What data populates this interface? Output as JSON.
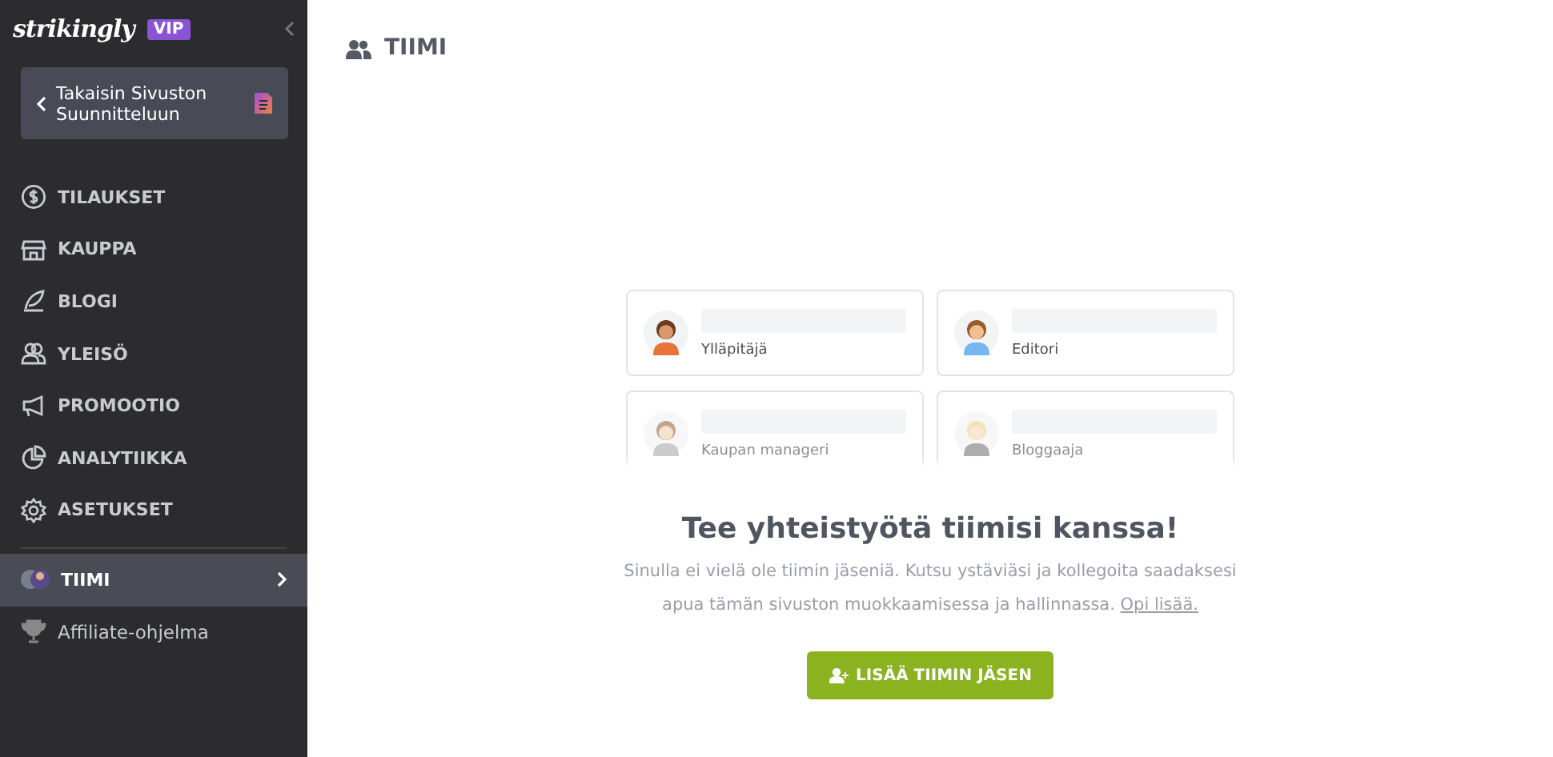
{
  "sidebar": {
    "logo": "strikingly",
    "badge": "VIP",
    "back_button": "Takaisin Sivuston Suunnitteluun",
    "items": [
      {
        "label": "TILAUKSET",
        "kind": "main",
        "selected": false
      },
      {
        "label": "KAUPPA",
        "kind": "main",
        "selected": false
      },
      {
        "label": "BLOGI",
        "kind": "main",
        "selected": false
      },
      {
        "label": "YLEISÖ",
        "kind": "main",
        "selected": false
      },
      {
        "label": "PROMOOTIO",
        "kind": "main",
        "selected": false
      },
      {
        "label": "ANALYTIIKKA",
        "kind": "main",
        "selected": false
      },
      {
        "label": "ASETUKSET",
        "kind": "main",
        "selected": false
      },
      {
        "label": "TIIMI",
        "kind": "main",
        "selected": true
      },
      {
        "label": "Affiliate-ohjelma",
        "kind": "secondary",
        "selected": false
      }
    ]
  },
  "page": {
    "title": "TIIMI",
    "roles": [
      {
        "label": "Ylläpitäjä",
        "faded": false
      },
      {
        "label": "Editori",
        "faded": false
      },
      {
        "label": "Kaupan manageri",
        "faded": true
      },
      {
        "label": "Bloggaaja",
        "faded": true
      }
    ],
    "heading": "Tee yhteistyötä tiimisi kanssa!",
    "text": "Sinulla ei vielä ole tiimin jäseniä. Kutsu ystäviäsi ja kollegoita saadaksesi apua tämän sivuston muokkaamisessa ja hallinnassa.",
    "link": "Opi lisää.",
    "button": "LISÄÄ TIIMIN JÄSEN"
  }
}
